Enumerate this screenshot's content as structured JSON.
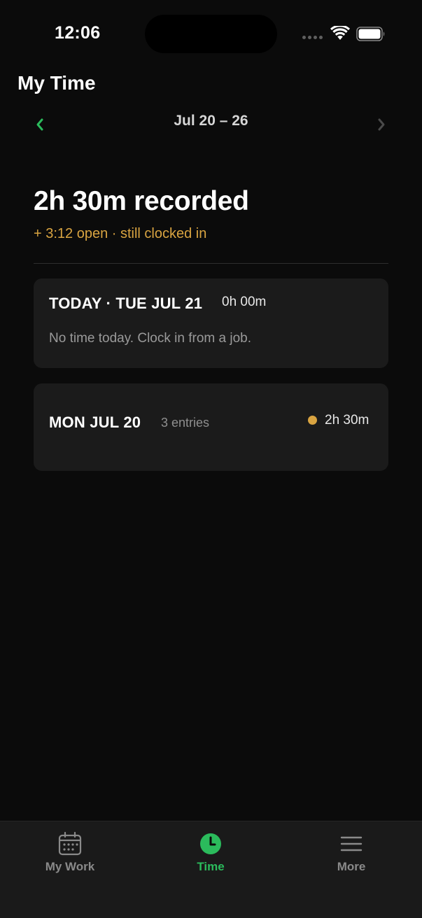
{
  "status_bar": {
    "time": "12:06"
  },
  "header": {
    "title": "My Time",
    "week_range": "Jul 20 – 26",
    "prev_icon": "chevron-left-icon",
    "next_icon": "chevron-right-icon"
  },
  "summary": {
    "total": "2h 30m recorded",
    "open_note": "+ 3:12 open · still clocked in"
  },
  "days": [
    {
      "title": "TODAY · TUE JUL 21",
      "total": "0h 00m",
      "empty_message": "No time today. Clock in from a job."
    },
    {
      "title": "MON JUL 20",
      "entries": "3 entries",
      "total": "2h 30m"
    }
  ],
  "tabs": [
    {
      "label": "My Work",
      "icon": "calendar-icon"
    },
    {
      "label": "Time",
      "icon": "clock-icon"
    },
    {
      "label": "More",
      "icon": "menu-icon"
    }
  ],
  "colors": {
    "background": "#0b0b0b",
    "card": "#1b1b1b",
    "accent_green": "#2bbb5c",
    "open_amber": "#d9a441",
    "inactive_tab": "#8a8a8a"
  }
}
